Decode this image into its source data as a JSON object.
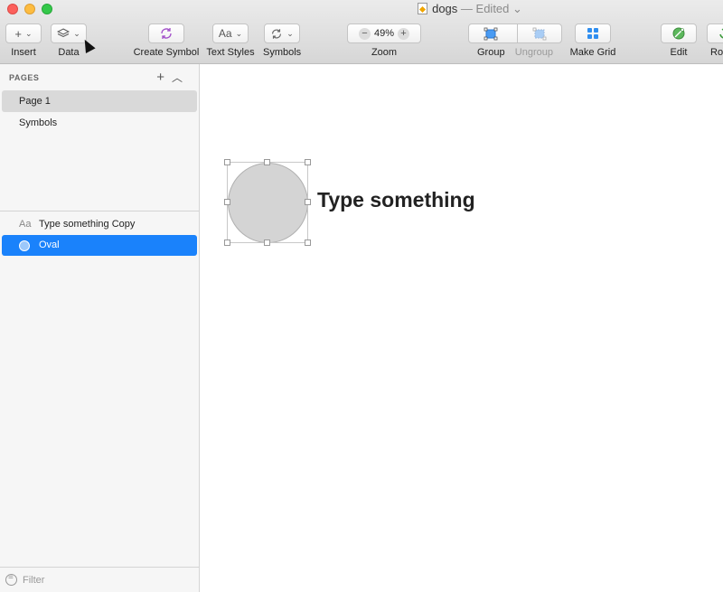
{
  "window": {
    "doc_name": "dogs",
    "edited": "— Edited ⌄"
  },
  "toolbar": {
    "insert": {
      "icon": "+",
      "label": "Insert"
    },
    "data": {
      "label": "Data"
    },
    "create_symbol": {
      "label": "Create Symbol"
    },
    "text_styles": {
      "icon": "Aa",
      "label": "Text Styles"
    },
    "symbols": {
      "label": "Symbols"
    },
    "zoom": {
      "value": "49%",
      "minus": "−",
      "plus": "+",
      "label": "Zoom"
    },
    "group": {
      "label": "Group"
    },
    "ungroup": {
      "label": "Ungroup"
    },
    "make_grid": {
      "label": "Make Grid"
    },
    "edit": {
      "label": "Edit"
    },
    "rotate": {
      "label": "Rot"
    }
  },
  "sidebar": {
    "pages_header": "PAGES",
    "pages": [
      {
        "label": "Page 1",
        "selected": true
      },
      {
        "label": "Symbols",
        "selected": false
      }
    ],
    "layers": [
      {
        "icon": "Aa",
        "label": "Type something Copy",
        "selected": false
      },
      {
        "label": "Oval",
        "selected": true
      }
    ],
    "filter_placeholder": "Filter"
  },
  "canvas": {
    "text": "Type something"
  },
  "colors": {
    "accent": "#1a82fb",
    "oval_fill": "#d4d4d4"
  }
}
